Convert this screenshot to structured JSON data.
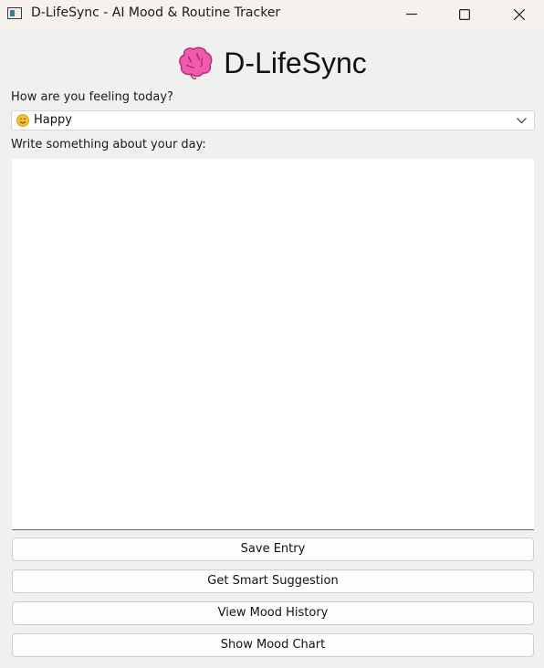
{
  "window": {
    "title": "D-LifeSync - AI Mood & Routine Tracker",
    "controls": [
      "minimize-icon",
      "maximize-icon",
      "close-icon"
    ]
  },
  "header": {
    "icon": "brain-icon",
    "title": "D-LifeSync"
  },
  "mood": {
    "label": "How are you feeling today?",
    "selected_emoji": "smiling-face-icon",
    "selected": "Happy"
  },
  "journal": {
    "label": "Write something about your day:",
    "value": ""
  },
  "buttons": {
    "save": "Save Entry",
    "suggestion": "Get Smart Suggestion",
    "history": "View Mood History",
    "chart": "Show Mood Chart"
  },
  "colors": {
    "brain": "#f25ab0",
    "emoji": "#f7c22b"
  }
}
